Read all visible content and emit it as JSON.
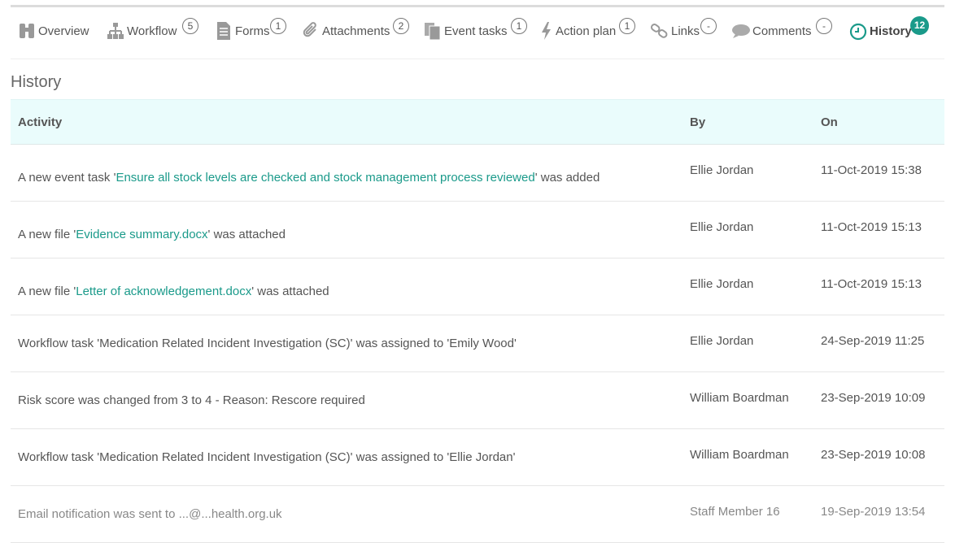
{
  "tabs": [
    {
      "label": "Overview",
      "icon": "binoculars-icon",
      "badge": ""
    },
    {
      "label": "Workflow",
      "icon": "workflow-icon",
      "badge": "5"
    },
    {
      "label": "Forms",
      "icon": "form-icon",
      "badge": "1"
    },
    {
      "label": "Attachments",
      "icon": "paperclip-icon",
      "badge": "2"
    },
    {
      "label": "Event tasks",
      "icon": "tasks-icon",
      "badge": "1"
    },
    {
      "label": "Action plan",
      "icon": "lightning-icon",
      "badge": "1"
    },
    {
      "label": "Links",
      "icon": "link-icon",
      "badge": "-"
    },
    {
      "label": "Comments",
      "icon": "comment-icon",
      "badge": "-"
    },
    {
      "label": "History",
      "icon": "clock-icon",
      "badge": "12"
    }
  ],
  "colors": {
    "accent": "#1a9a8a",
    "header_bg": "#eafcfc"
  },
  "section_title": "History",
  "columns": {
    "activity": "Activity",
    "by": "By",
    "on": "On"
  },
  "rows": [
    {
      "pre": "A new event task '",
      "link": "Ensure all stock levels are checked and stock management process reviewed",
      "post": "' was added",
      "by": "Ellie Jordan",
      "on": "11-Oct-2019 15:38"
    },
    {
      "pre": "A new file '",
      "link": "Evidence summary.docx",
      "post": "' was attached",
      "by": "Ellie Jordan",
      "on": "11-Oct-2019 15:13"
    },
    {
      "pre": "A new file '",
      "link": "Letter of acknowledgement.docx",
      "post": "' was attached",
      "by": "Ellie Jordan",
      "on": "11-Oct-2019 15:13"
    },
    {
      "pre": "Workflow task 'Medication Related Incident Investigation (SC)' was assigned to 'Emily Wood'",
      "link": "",
      "post": "",
      "by": "Ellie Jordan",
      "on": "24-Sep-2019 11:25"
    },
    {
      "pre": "Risk score was changed from 3 to 4 - Reason: Rescore required",
      "link": "",
      "post": "",
      "by": "William Boardman",
      "on": "23-Sep-2019 10:09"
    },
    {
      "pre": "Workflow task 'Medication Related Incident Investigation (SC)' was assigned to 'Ellie Jordan'",
      "link": "",
      "post": "",
      "by": "William Boardman",
      "on": "23-Sep-2019 10:08"
    },
    {
      "pre": "Email notification was sent to ...@...health.org.uk",
      "link": "",
      "post": "",
      "by": "Staff Member 16",
      "on": "19-Sep-2019 13:54"
    }
  ]
}
